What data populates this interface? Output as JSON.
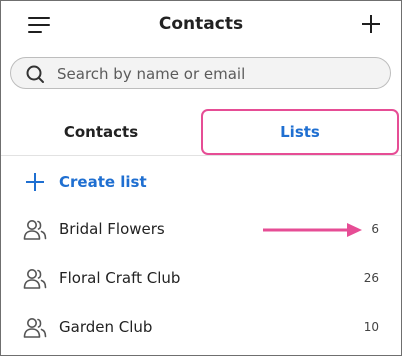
{
  "header": {
    "title": "Contacts",
    "menu_icon": "hamburger-menu-icon",
    "add_icon": "plus-icon"
  },
  "search": {
    "placeholder": "Search by name or email",
    "value": ""
  },
  "tabs": [
    {
      "label": "Contacts",
      "active": false
    },
    {
      "label": "Lists",
      "active": true
    }
  ],
  "create_list": {
    "label": "Create list"
  },
  "lists": [
    {
      "name": "Bridal Flowers",
      "count": "6"
    },
    {
      "name": "Floral Craft Club",
      "count": "26"
    },
    {
      "name": "Garden Club",
      "count": "10"
    }
  ],
  "colors": {
    "accent": "#1f6fd1",
    "highlight": "#e64d95",
    "text": "#222222"
  }
}
